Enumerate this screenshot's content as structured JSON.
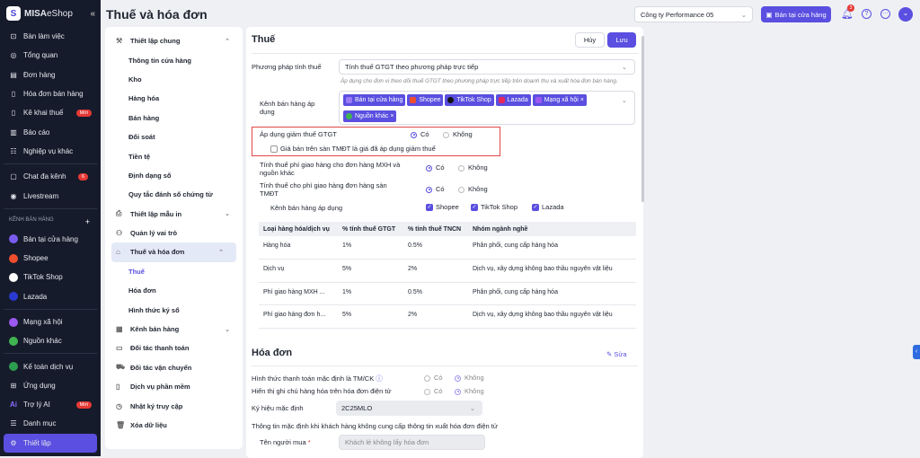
{
  "sidebar": {
    "brand": "MISA",
    "brand2": "eShop",
    "collapse": "«",
    "items": [
      {
        "label": "Bàn làm việc"
      },
      {
        "label": "Tổng quan"
      },
      {
        "label": "Đơn hàng"
      },
      {
        "label": "Hóa đơn bán hàng"
      },
      {
        "label": "Kê khai thuế",
        "badge": "Mới"
      },
      {
        "label": "Báo cáo"
      },
      {
        "label": "Nghiệp vụ khác"
      }
    ],
    "items2": [
      {
        "label": "Chat đa kênh",
        "badge": "6"
      },
      {
        "label": "Livestream"
      }
    ],
    "section": "KÊNH BÁN HÀNG",
    "section_add": "+",
    "channels": [
      {
        "label": "Bán tại cửa hàng",
        "color": "#7b5cf0"
      },
      {
        "label": "Shopee",
        "color": "#ee4d2d"
      },
      {
        "label": "TikTok Shop",
        "color": "#111111"
      },
      {
        "label": "Lazada",
        "color": "#2a3ad1"
      }
    ],
    "channels2": [
      {
        "label": "Mạng xã hội",
        "color": "#9b59f0"
      },
      {
        "label": "Nguồn khác",
        "color": "#3fb34f"
      }
    ],
    "bottom": [
      {
        "label": "Kế toán dịch vụ"
      },
      {
        "label": "Ứng dụng"
      },
      {
        "label": "Trợ lý AI",
        "badge": "Mới"
      },
      {
        "label": "Danh mục"
      },
      {
        "label": "Thiết lập"
      }
    ]
  },
  "page_title": "Thuế và hóa đơn",
  "topbar": {
    "company": "Công ty Performance 05",
    "store_button": "Bán tại cửa hàng",
    "notif_count": "3"
  },
  "nav": {
    "general": "Thiết lập chung",
    "general_items": [
      "Thông tin cửa hàng",
      "Kho",
      "Hàng hóa",
      "Bán hàng",
      "Đối soát",
      "Tiền tệ",
      "Định dạng số",
      "Quy tắc đánh số chứng từ"
    ],
    "print": "Thiết lập mẫu in",
    "roles": "Quản lý vai trò",
    "tax": "Thuế và hóa đơn",
    "tax_items": [
      "Thuế",
      "Hóa đơn",
      "Hình thức ký số"
    ],
    "others": [
      "Kênh bán hàng",
      "Đối tác thanh toán",
      "Đối tác vận chuyển",
      "Dịch vụ phần mềm",
      "Nhật ký truy cập",
      "Xóa dữ liệu"
    ]
  },
  "tax": {
    "title": "Thuế",
    "cancel": "Hủy",
    "save": "Lưu",
    "method_label": "Phương pháp tính thuế",
    "method_value": "Tính thuế GTGT theo phương pháp trực tiếp",
    "method_hint": "Áp dụng cho đơn vị theo dõi thuế GTGT theo phương pháp trực tiếp trên doanh thu và xuất hóa đơn bán hàng.",
    "channels_label": "Kênh bán hàng áp dụng",
    "channel_tags": [
      "Bán tại cửa hàng",
      "Shopee",
      "TikTok Shop",
      "Lazada",
      "Mạng xã hội",
      "Nguồn khác"
    ],
    "reduce_label": "Áp dụng giảm thuế GTGT",
    "yes": "Có",
    "no": "Không",
    "reduce_check": "Giá bán trên sàn TMĐT là giá đã áp dụng giảm thuế",
    "ship_social_label": "Tính thuế phí giao hàng cho đơn hàng MXH và nguồn khác",
    "ship_ecom_label": "Tính thuế cho phí giao hàng đơn hàng sàn TMĐT",
    "apply_channels_label": "Kênh bán hàng áp dụng",
    "apply_channels": [
      "Shopee",
      "TikTok Shop",
      "Lazada"
    ],
    "table": {
      "headers": [
        "Loại hàng hóa/dịch vụ",
        "% tính thuế GTGT",
        "% tính thuế TNCN",
        "Nhóm ngành nghề"
      ],
      "rows": [
        [
          "Hàng hóa",
          "1%",
          "0.5%",
          "Phân phối, cung cấp hàng hóa"
        ],
        [
          "Dịch vụ",
          "5%",
          "2%",
          "Dịch vụ, xây dựng không bao thầu nguyên vật liệu"
        ],
        [
          "Phí giao hàng MXH ...",
          "1%",
          "0.5%",
          "Phân phối, cung cấp hàng hóa"
        ],
        [
          "Phí giao hàng đơn h...",
          "5%",
          "2%",
          "Dịch vụ, xây dựng không bao thầu nguyên vật liệu"
        ]
      ]
    }
  },
  "invoice": {
    "title": "Hóa đơn",
    "edit": "Sửa",
    "pay_label": "Hình thức thanh toán mặc định là TM/CK",
    "note_label": "Hiển thị ghi chú hàng hóa trên hóa đơn điện tử",
    "symbol_label": "Ký hiệu mặc định",
    "symbol_value": "2C25MLO",
    "default_info": "Thông tin mặc định khi khách hàng không cung cấp thông tin xuất hóa đơn điện tử",
    "buyer_label": "Tên người mua",
    "required": "*",
    "buyer_value": "Khách lẻ không lấy hóa đơn"
  }
}
